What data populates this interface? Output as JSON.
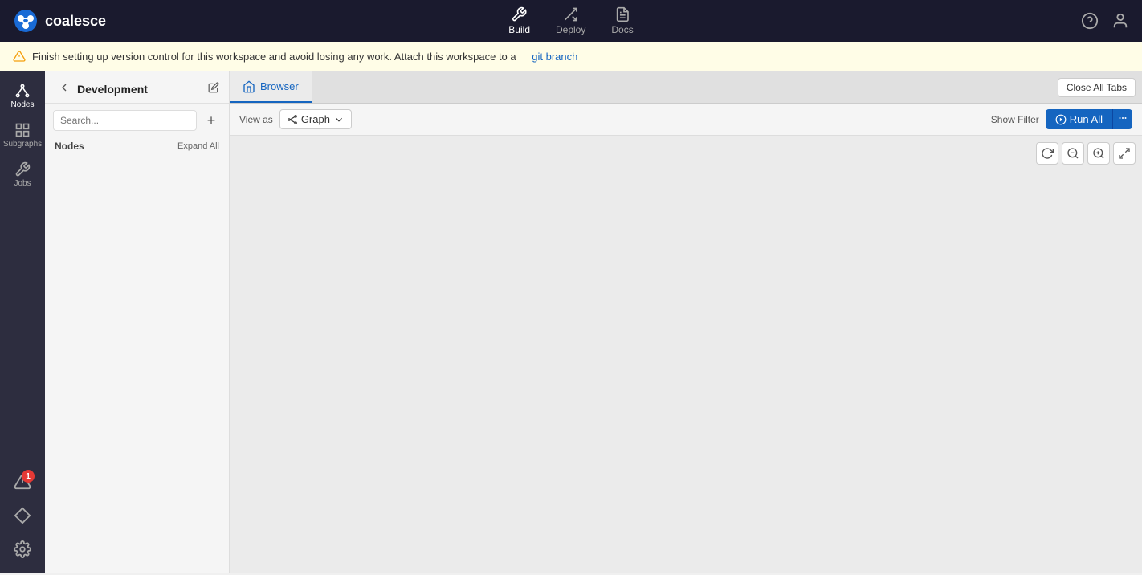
{
  "app": {
    "logo_text": "coalesce",
    "logo_icon": "coalesce-icon"
  },
  "top_nav": {
    "items": [
      {
        "id": "build",
        "label": "Build",
        "active": true
      },
      {
        "id": "deploy",
        "label": "Deploy",
        "active": false
      },
      {
        "id": "docs",
        "label": "Docs",
        "active": false
      }
    ],
    "right_icons": [
      "help-icon",
      "user-icon"
    ]
  },
  "banner": {
    "message_start": "Finish setting up version control for this workspace and avoid losing any work. Attach this workspace to a",
    "link_text": "git branch",
    "icon": "warning-icon"
  },
  "left_panel": {
    "workspace_name": "Development",
    "search_placeholder": "Search...",
    "add_label": "+",
    "nodes_label": "Nodes",
    "expand_all_label": "Expand All"
  },
  "sidebar_items": [
    {
      "id": "nodes",
      "label": "Nodes",
      "active": true
    },
    {
      "id": "subgraphs",
      "label": "Subgraphs",
      "active": false
    },
    {
      "id": "jobs",
      "label": "Jobs",
      "active": false
    }
  ],
  "sidebar_bottom_items": [
    {
      "id": "alerts",
      "label": "alerts-icon",
      "badge": "1"
    },
    {
      "id": "diamond",
      "label": "diamond-icon"
    },
    {
      "id": "settings",
      "label": "settings-icon"
    }
  ],
  "tabs": [
    {
      "id": "browser",
      "label": "Browser",
      "active": true
    }
  ],
  "close_all_tabs_label": "Close All Tabs",
  "toolbar": {
    "view_as_label": "View as",
    "graph_label": "Graph",
    "show_filter_label": "Show Filter",
    "run_all_label": "Run All"
  },
  "canvas": {
    "empty": true
  }
}
